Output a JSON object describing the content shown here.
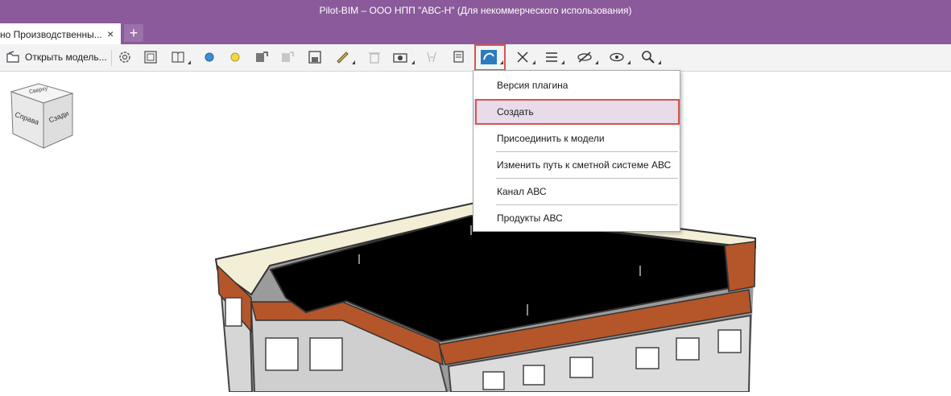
{
  "window": {
    "title": "Pilot-BIM – ООО НПП \"АВС-Н\" (Для некоммерческого использования)"
  },
  "tabs": [
    {
      "label": "но Производственны...",
      "close": "×"
    }
  ],
  "tab_add": "+",
  "toolbar": {
    "open_model_label": "Открыть модель...",
    "icons": [
      "open-folder-icon",
      "settings-icon",
      "frame-icon",
      "book-icon",
      "blue-dot-icon",
      "yellow-dot-icon",
      "box-export-icon",
      "box-import-icon",
      "save-icon",
      "measure-icon",
      "trash-icon",
      "camera-icon",
      "brackets-icon",
      "report-icon",
      "abc-plugin-icon",
      "wand-icon",
      "list-icon",
      "hide-icon",
      "view-icon",
      "search-icon"
    ]
  },
  "plugin_menu": {
    "items": [
      "Версия плагина",
      "Создать",
      "Присоединить к модели",
      "Изменить путь к сметной системе АВС",
      "Канал АВС",
      "Продукты АВС"
    ],
    "selected": "Создать"
  },
  "viewcube": {
    "faces": [
      "Справа",
      "Сзади",
      "Сверху"
    ]
  },
  "colors": {
    "accent": "#8a5a9a",
    "highlight": "#d9534f",
    "facade_orange": "#b5552a",
    "roof": "#000000"
  }
}
